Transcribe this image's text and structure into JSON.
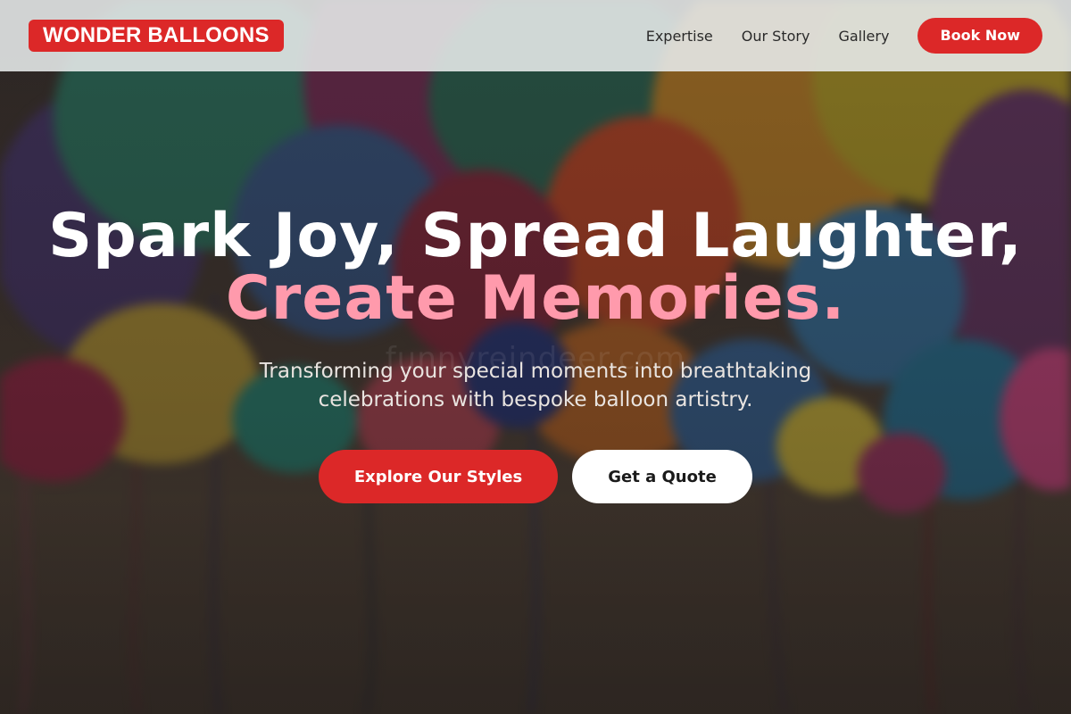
{
  "header": {
    "logo": "WONDER BALLOONS",
    "nav": [
      "Expertise",
      "Our Story",
      "Gallery"
    ],
    "cta": "Book Now"
  },
  "hero": {
    "headline_line1": "Spark Joy, Spread Laughter,",
    "headline_line2": "Create Memories.",
    "subtitle": "Transforming your special moments into breathtaking celebrations with bespoke balloon artistry.",
    "primary_cta": "Explore Our Styles",
    "secondary_cta": "Get a Quote",
    "background_image": "balloons-photo"
  },
  "colors": {
    "accent": "#dc2828",
    "headline_accent": "#ff9aac",
    "header_bg": "#e8ecec"
  }
}
